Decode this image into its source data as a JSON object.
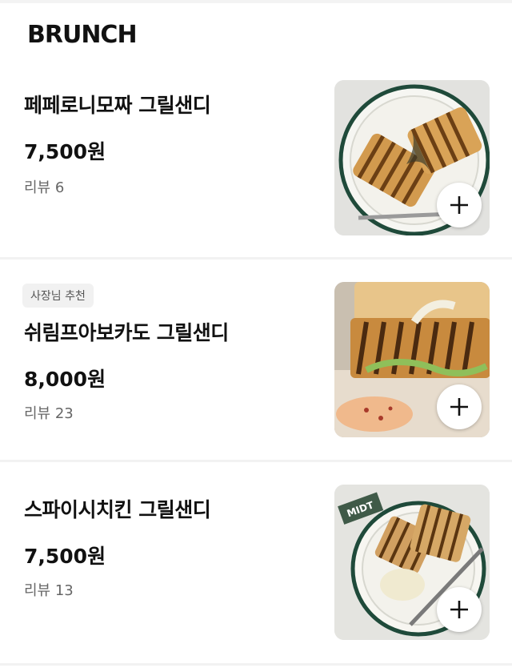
{
  "section": {
    "title": "BRUNCH"
  },
  "items": [
    {
      "name": "페페로니모짜 그릴샌디",
      "price": "7,500원",
      "review": "리뷰 6",
      "badge": ""
    },
    {
      "name": "쉬림프아보카도 그릴샌디",
      "price": "8,000원",
      "review": "리뷰 23",
      "badge": "사장님 추천"
    },
    {
      "name": "스파이시치킨 그릴샌디",
      "price": "7,500원",
      "review": "리뷰 13",
      "badge": ""
    }
  ],
  "icons": {
    "add": "plus-icon"
  },
  "colors": {
    "divider": "#f2f2f2",
    "badge_bg": "#f1f1f1",
    "plate_rim": "#1f4a3a"
  },
  "thumbs": {
    "item3_label": "MIDT"
  }
}
